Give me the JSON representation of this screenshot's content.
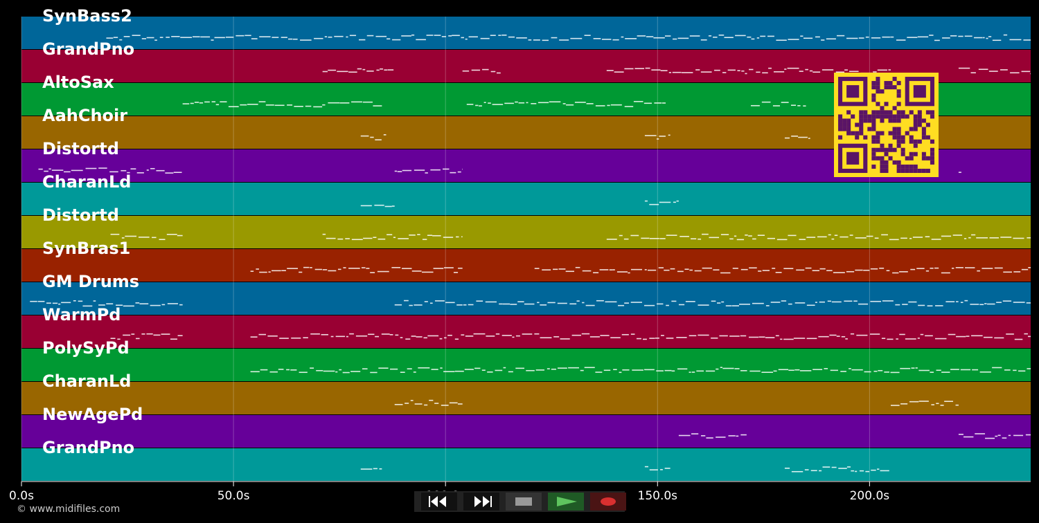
{
  "timeline": {
    "ticks": [
      {
        "label": "0.0s",
        "sec": 0
      },
      {
        "label": "50.0s",
        "sec": 50
      },
      {
        "label": "100.0s",
        "sec": 100
      },
      {
        "label": "150.0s",
        "sec": 150
      },
      {
        "label": "200.0s",
        "sec": 200
      }
    ],
    "duration_sec": 238
  },
  "tracks": [
    {
      "name": "SynBass2",
      "color": "#006699",
      "spans": [
        [
          20,
          238
        ]
      ]
    },
    {
      "name": "GrandPno",
      "color": "#990033",
      "spans": [
        [
          71,
          88
        ],
        [
          104,
          113
        ],
        [
          138,
          205
        ],
        [
          221,
          238
        ]
      ]
    },
    {
      "name": "AltoSax",
      "color": "#009933",
      "spans": [
        [
          38,
          85
        ],
        [
          105,
          152
        ],
        [
          172,
          185
        ]
      ]
    },
    {
      "name": "AahChoir",
      "color": "#996600",
      "spans": [
        [
          80,
          86
        ],
        [
          147,
          153
        ],
        [
          180,
          186
        ]
      ]
    },
    {
      "name": "Distortd",
      "color": "#660099",
      "spans": [
        [
          4,
          38
        ],
        [
          88,
          104
        ],
        [
          221,
          221
        ]
      ]
    },
    {
      "name": "CharanLd",
      "color": "#009999",
      "spans": [
        [
          80,
          88
        ],
        [
          147,
          155
        ]
      ]
    },
    {
      "name": "Distortd",
      "color": "#999900",
      "spans": [
        [
          21,
          38
        ],
        [
          71,
          104
        ],
        [
          138,
          238
        ]
      ]
    },
    {
      "name": "SynBras1",
      "color": "#992200",
      "spans": [
        [
          54,
          104
        ],
        [
          121,
          238
        ]
      ]
    },
    {
      "name": "GM Drums",
      "color": "#006699",
      "spans": [
        [
          2,
          38
        ],
        [
          88,
          238
        ]
      ]
    },
    {
      "name": "WarmPd",
      "color": "#990033",
      "spans": [
        [
          21,
          38
        ],
        [
          54,
          238
        ]
      ]
    },
    {
      "name": "PolySyPd",
      "color": "#009933",
      "spans": [
        [
          54,
          238
        ]
      ]
    },
    {
      "name": "CharanLd",
      "color": "#996600",
      "spans": [
        [
          88,
          104
        ],
        [
          205,
          221
        ]
      ]
    },
    {
      "name": "NewAgePd",
      "color": "#660099",
      "spans": [
        [
          155,
          171
        ],
        [
          221,
          238
        ]
      ]
    },
    {
      "name": "GrandPno",
      "color": "#009999",
      "spans": [
        [
          80,
          85
        ],
        [
          147,
          153
        ],
        [
          180,
          205
        ]
      ]
    }
  ],
  "transport": {
    "rewind": "rewind-icon",
    "fast_forward": "fast-forward-icon",
    "stop": "stop-icon",
    "play": "play-icon",
    "record": "record-icon"
  },
  "footer": {
    "copyright": "© www.midifiles.com"
  },
  "qr": {
    "color": "#ffdd22",
    "dark": "#5a1466"
  }
}
